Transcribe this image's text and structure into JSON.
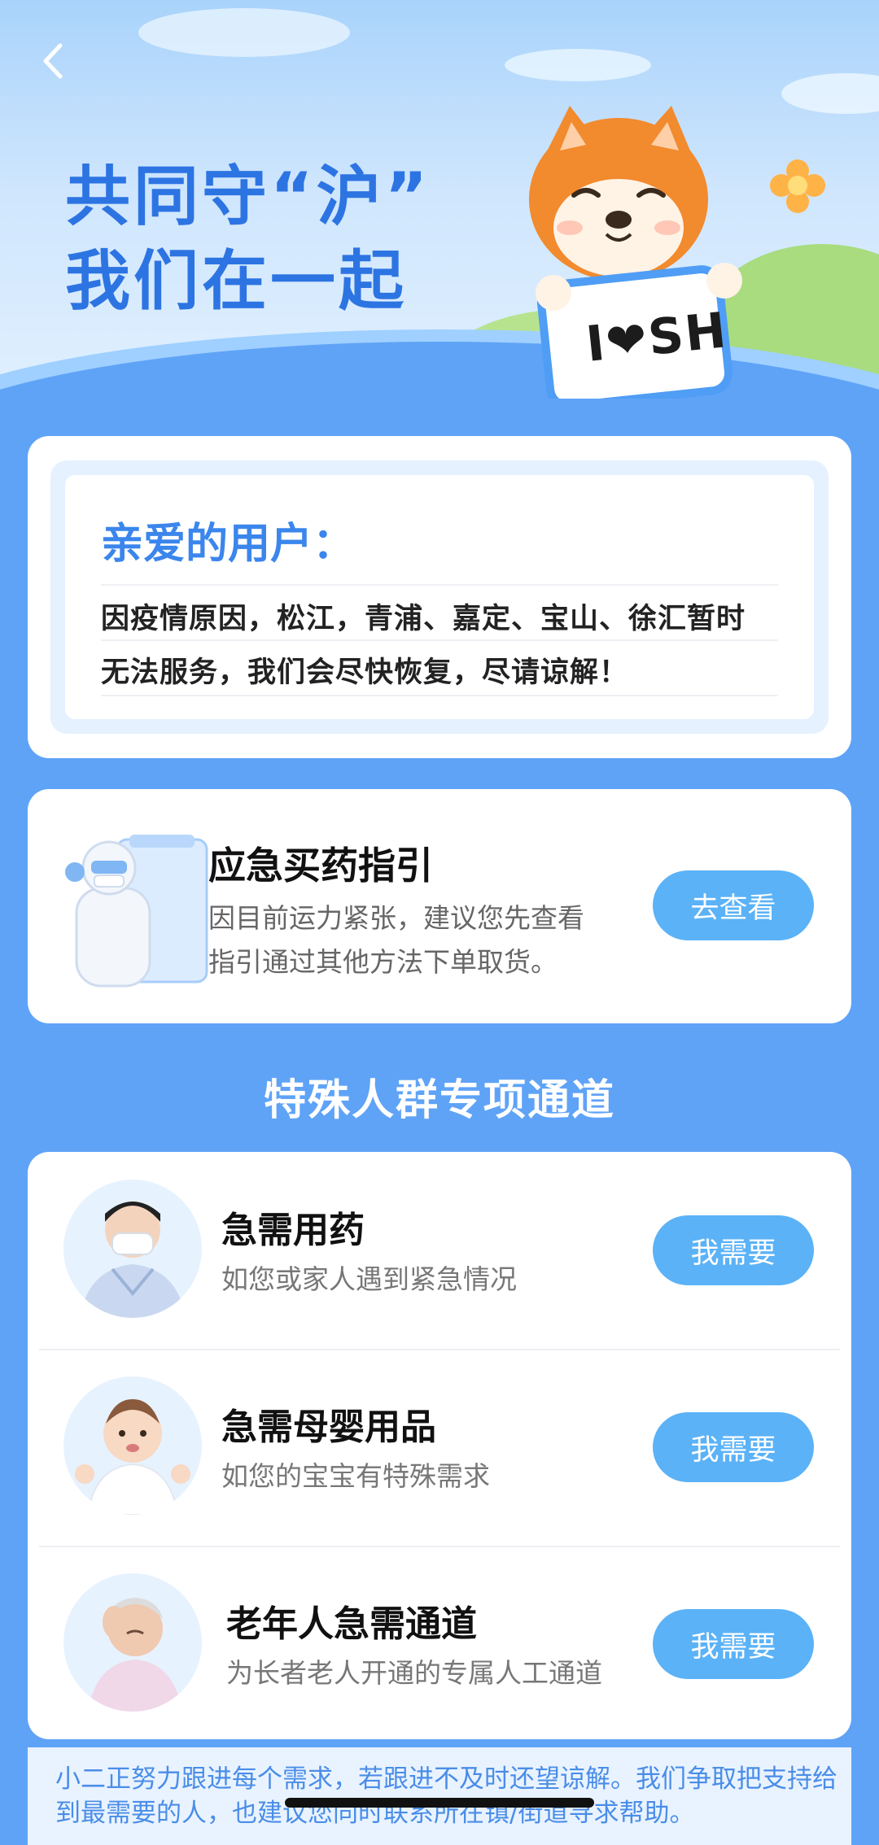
{
  "hero": {
    "title_line1": "共同守“沪”",
    "title_line2": "我们在一起",
    "sign_text": "I❤SH"
  },
  "notice": {
    "heading": "亲爱的用户：",
    "line1": "因疫情原因，松江，青浦、嘉定、宝山、徐汇暂时",
    "line2": "无法服务，我们会尽快恢复，尽请谅解！"
  },
  "guide": {
    "title": "应急买药指引",
    "desc_line1": "因目前运力紧张，建议您先查看",
    "desc_line2": "指引通过其他方法下单取货。",
    "button_label": "去查看"
  },
  "section_title": "特殊人群专项通道",
  "channels": [
    {
      "title": "急需用药",
      "subtitle": "如您或家人遇到紧急情况",
      "button_label": "我需要"
    },
    {
      "title": "急需母婴用品",
      "subtitle": "如您的宝宝有特殊需求",
      "button_label": "我需要"
    },
    {
      "title": "老年人急需通道",
      "subtitle": "为长者老人开通的专属人工通道",
      "button_label": "我需要"
    }
  ],
  "footer_text": "小二正努力跟进每个需求，若跟进不及时还望谅解。我们争取把支持给到最需要的人，也建议您同时联系所在镇/街道寻求帮助。",
  "colors": {
    "page_bg": "#5fa3f7",
    "accent_blue": "#3b86ec",
    "button_blue": "#5bb2f7"
  },
  "icons": {
    "back": "chevron-left-icon"
  }
}
